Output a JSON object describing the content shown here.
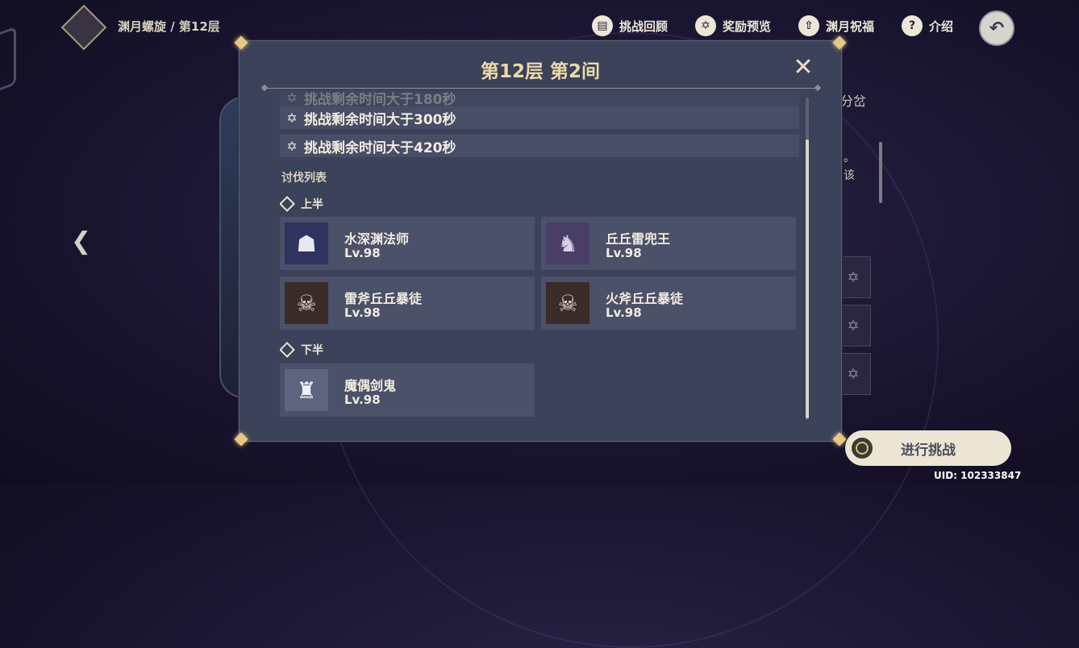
{
  "topbar": {
    "breadcrumb": "渊月螺旋 / 第12层",
    "nav": [
      {
        "label": "挑战回顾",
        "icon": "book-icon",
        "glyph": "▤"
      },
      {
        "label": "奖励预览",
        "icon": "star-icon",
        "glyph": "✡"
      },
      {
        "label": "渊月祝福",
        "icon": "blessing-icon",
        "glyph": "⇧"
      },
      {
        "label": "介绍",
        "icon": "question-icon",
        "glyph": "?"
      }
    ],
    "back_glyph": "↶"
  },
  "modal": {
    "title": "第12层 第2间",
    "close_glyph": "✕",
    "conditions": [
      {
        "text": "挑战剩余时间大于180秒"
      },
      {
        "text": "挑战剩余时间大于300秒"
      },
      {
        "text": "挑战剩余时间大于420秒"
      }
    ],
    "enemy_list_label": "讨伐列表",
    "first_half": {
      "label": "上半",
      "enemies": [
        {
          "name": "水深渊法师",
          "level": "Lv.98",
          "glyph": "☗",
          "bg": "#2e3360"
        },
        {
          "name": "丘丘雷兜王",
          "level": "Lv.98",
          "glyph": "♞",
          "bg": "#4a3d66"
        },
        {
          "name": "雷斧丘丘暴徒",
          "level": "Lv.98",
          "glyph": "☠",
          "bg": "#3b2c2a"
        },
        {
          "name": "火斧丘丘暴徒",
          "level": "Lv.98",
          "glyph": "☠",
          "bg": "#3b2c2a"
        }
      ]
    },
    "second_half": {
      "label": "下半",
      "enemies": [
        {
          "name": "魔偶剑鬼",
          "level": "Lv.98",
          "glyph": "♜",
          "bg": "#5b6580"
        }
      ]
    }
  },
  "background": {
    "right_title": "分岔",
    "right_text_1": "。",
    "right_text_2": "该"
  },
  "start_button": {
    "label": "进行挑战"
  },
  "uid": "UID: 102333847"
}
